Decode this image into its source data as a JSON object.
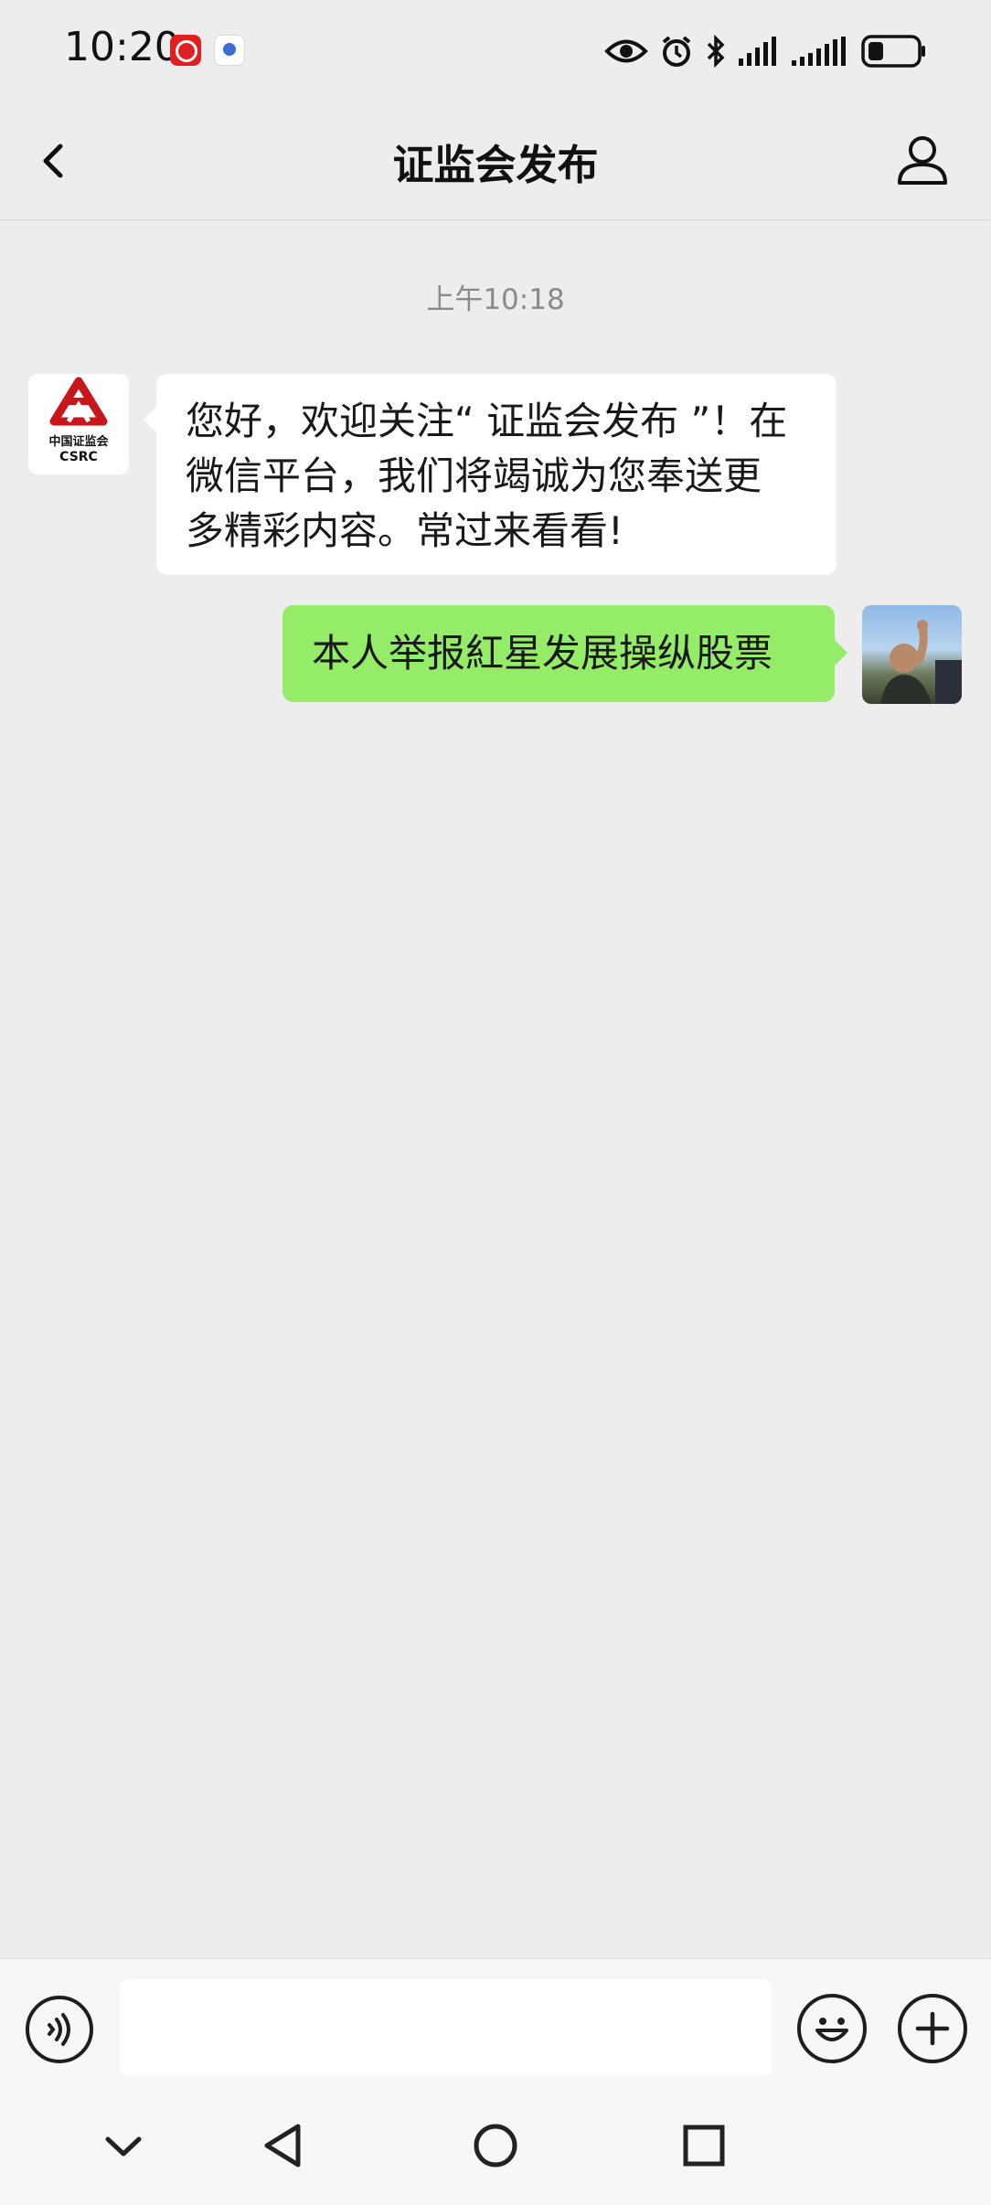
{
  "status_bar": {
    "time": "10:20",
    "icons": [
      "app-notification-icon",
      "baidu-app-icon",
      "eye-icon",
      "alarm-icon",
      "bluetooth-icon",
      "signal-icon",
      "signal-icon",
      "battery-icon"
    ]
  },
  "header": {
    "title": "证监会发布",
    "back_icon": "chevron-left-icon",
    "profile_icon": "person-icon"
  },
  "chat": {
    "timestamp": "上午10:18",
    "messages": [
      {
        "from": "official-account",
        "avatar_text_cn": "中国证监会",
        "avatar_text_en": "CSRC",
        "lines": [
          "您好，欢迎关注“ 证监会发布 ”！在",
          "微信平台，我们将竭诚为您奉送更",
          "多精彩内容。常过来看看!"
        ]
      },
      {
        "from": "me",
        "text": "本人举报紅星发展操纵股票"
      }
    ]
  },
  "input_bar": {
    "value": "",
    "placeholder": "",
    "icons": [
      "voice-icon",
      "emoji-icon",
      "plus-icon"
    ]
  },
  "system_nav": {
    "icons": [
      "chevron-down-icon",
      "back-triangle-icon",
      "home-circle-icon",
      "recents-square-icon"
    ]
  },
  "colors": {
    "background": "#ededed",
    "incoming_bubble": "#ffffff",
    "outgoing_bubble": "#95ec69",
    "brand_red": "#c8161d"
  }
}
